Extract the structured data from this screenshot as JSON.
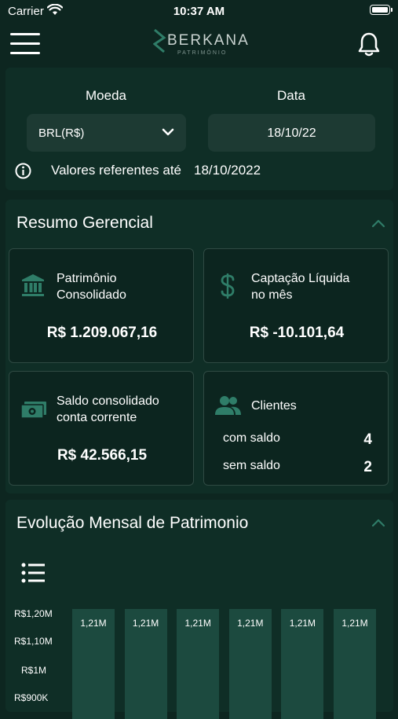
{
  "status_bar": {
    "carrier": "Carrier",
    "time": "10:37 AM"
  },
  "header": {
    "logo_text": "BERKANA",
    "logo_subtitle": "PATRIMÔNIO"
  },
  "filters": {
    "currency_label": "Moeda",
    "currency_value": "BRL(R$)",
    "date_label": "Data",
    "date_value": "18/10/22",
    "info_text": "Valores referentes até",
    "info_date": "18/10/2022"
  },
  "summary": {
    "title": "Resumo Gerencial",
    "tiles": {
      "patrimonio": {
        "title_line1": "Patrimônio",
        "title_line2": "Consolidado",
        "value": "R$ 1.209.067,16"
      },
      "captacao": {
        "title_line1": "Captação Líquida",
        "title_line2": "no mês",
        "value": "R$ -10.101,64"
      },
      "saldo": {
        "title_line1": "Saldo consolidado",
        "title_line2": "conta corrente",
        "value": "R$ 42.566,15"
      },
      "clientes": {
        "title": "Clientes",
        "rows": [
          {
            "label": "com saldo",
            "count": "4"
          },
          {
            "label": "sem saldo",
            "count": "2"
          }
        ]
      }
    }
  },
  "evolution": {
    "title": "Evolução Mensal de Patrimonio"
  },
  "chart_data": {
    "type": "bar",
    "y_ticks": [
      "R$1,20M",
      "R$1,10M",
      "R$1M",
      "R$900K"
    ],
    "values": [
      1.21,
      1.21,
      1.21,
      1.21,
      1.21,
      1.21
    ],
    "data_labels": [
      "1,21M",
      "1,21M",
      "1,21M",
      "1,21M",
      "1,21M",
      "1,21M"
    ],
    "bar_color": "#1c4a3f"
  },
  "colors": {
    "background": "#0d2620",
    "card": "#0f2e26",
    "accent": "#2f7d68"
  }
}
